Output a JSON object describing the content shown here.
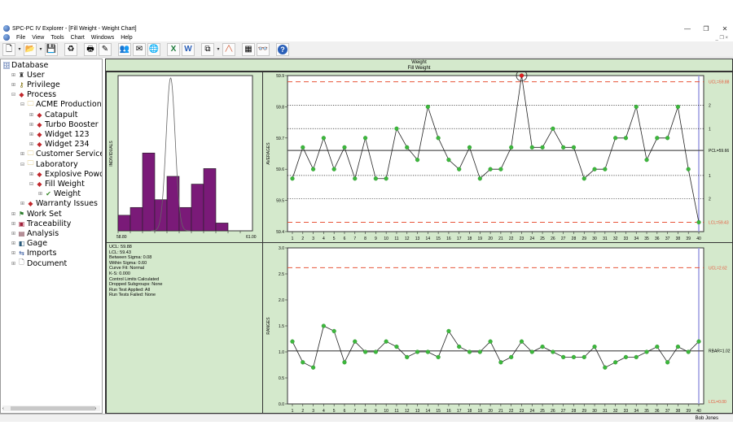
{
  "window": {
    "title": "SPC-PC IV Explorer - [Fill Weight - Weight Chart]",
    "controls": [
      "—",
      "❐",
      "✕"
    ]
  },
  "menu": [
    "File",
    "View",
    "Tools",
    "Chart",
    "Windows",
    "Help"
  ],
  "toolbar": [
    {
      "icon": "new-document-icon",
      "glyph": "🗋",
      "dropdown": true
    },
    {
      "icon": "open-folder-icon",
      "glyph": "📂",
      "dropdown": true
    },
    {
      "icon": "save-icon",
      "glyph": "💾"
    },
    {
      "icon": "refresh-icon",
      "glyph": "♻"
    },
    {
      "icon": "print-icon",
      "glyph": "🖶"
    },
    {
      "icon": "edit-icon",
      "glyph": "✎"
    },
    {
      "icon": "users-icon",
      "glyph": "👥"
    },
    {
      "icon": "message-icon",
      "glyph": "✉"
    },
    {
      "icon": "globe-icon",
      "glyph": "🌐"
    },
    {
      "icon": "excel-icon",
      "glyph": "X"
    },
    {
      "icon": "word-icon",
      "glyph": "W"
    },
    {
      "icon": "copy-icon",
      "glyph": "⧉",
      "dropdown": true
    },
    {
      "icon": "line-chart-icon",
      "glyph": "╱╲"
    },
    {
      "icon": "grid-icon",
      "glyph": "▦"
    },
    {
      "icon": "binoculars-icon",
      "glyph": "👓"
    },
    {
      "icon": "help-icon",
      "glyph": "?"
    }
  ],
  "tree": [
    {
      "label": "Database",
      "level": 0,
      "icon": "database-icon",
      "glyph": "🗄",
      "color": "#2a4f9a"
    },
    {
      "label": "User",
      "level": 1,
      "icon": "user-icon",
      "glyph": "♜",
      "color": "#333"
    },
    {
      "label": "Privilege",
      "level": 1,
      "icon": "key-icon",
      "glyph": "⚷",
      "color": "#7a6a00"
    },
    {
      "label": "Process",
      "level": 1,
      "icon": "process-icon",
      "glyph": "◆",
      "color": "#c0282d",
      "expanded": true
    },
    {
      "label": "ACME Production",
      "level": 2,
      "icon": "folder-icon",
      "glyph": "🗀",
      "color": "#c9a227",
      "expanded": true
    },
    {
      "label": "Catapult",
      "level": 3,
      "icon": "process-icon",
      "glyph": "◆",
      "color": "#c0282d"
    },
    {
      "label": "Turbo Booster",
      "level": 3,
      "icon": "process-icon",
      "glyph": "◆",
      "color": "#c0282d"
    },
    {
      "label": "Widget 123",
      "level": 3,
      "icon": "process-icon",
      "glyph": "◆",
      "color": "#c0282d"
    },
    {
      "label": "Widget 234",
      "level": 3,
      "icon": "process-icon",
      "glyph": "◆",
      "color": "#c0282d"
    },
    {
      "label": "Customer Service",
      "level": 2,
      "icon": "folder-icon",
      "glyph": "🗀",
      "color": "#c9a227"
    },
    {
      "label": "Laboratory",
      "level": 2,
      "icon": "folder-icon",
      "glyph": "🗀",
      "color": "#c9a227",
      "expanded": true
    },
    {
      "label": "Explosive Powder",
      "level": 3,
      "icon": "process-icon",
      "glyph": "◆",
      "color": "#c0282d"
    },
    {
      "label": "Fill Weight",
      "level": 3,
      "icon": "process-icon",
      "glyph": "◆",
      "color": "#c0282d",
      "expanded": true
    },
    {
      "label": "Weight",
      "level": 4,
      "icon": "check-icon",
      "glyph": "✔",
      "color": "#3a8a2a"
    },
    {
      "label": "Warranty Issues",
      "level": 2,
      "icon": "process-icon",
      "glyph": "◆",
      "color": "#c0282d"
    },
    {
      "label": "Work Set",
      "level": 1,
      "icon": "workset-icon",
      "glyph": "⚑",
      "color": "#2a7a2a"
    },
    {
      "label": "Traceability",
      "level": 1,
      "icon": "traceability-icon",
      "glyph": "▣",
      "color": "#a0203a"
    },
    {
      "label": "Analysis",
      "level": 1,
      "icon": "analysis-icon",
      "glyph": "▤",
      "color": "#6a2030"
    },
    {
      "label": "Gage",
      "level": 1,
      "icon": "gage-icon",
      "glyph": "◧",
      "color": "#2a5a7a"
    },
    {
      "label": "Imports",
      "level": 1,
      "icon": "imports-icon",
      "glyph": "⇆",
      "color": "#2a4f9a"
    },
    {
      "label": "Document",
      "level": 1,
      "icon": "document-icon",
      "glyph": "🗋",
      "color": "#555"
    }
  ],
  "header": {
    "line1": "Weight",
    "line2": "Fill Weight"
  },
  "stats": [
    "UCL: 59.88",
    "LCL: 59.43",
    "Between Sigma: 0.08",
    "Within Sigma: 0.60",
    "Curve Fit: Normal",
    "K-S: 0.000",
    "Control Limits Calculated",
    "Dropped Subgroups: None",
    "Run Test Applied: All",
    "Run Tests Failed: None"
  ],
  "status": {
    "user": "Bob Jones"
  },
  "colors": {
    "panel_bg": "#d4e9cc",
    "point": "#3cb83c",
    "out_of_control": "#e02020",
    "limit": "#e8553a",
    "histogram": "#7a1a78",
    "cursor": "#9a9ae0"
  },
  "chart_data": [
    {
      "type": "bar",
      "name": "histogram",
      "ylabel": "INDIVIDUALS",
      "xlim": [
        58.8,
        61.0
      ],
      "xtick_labels": [
        "58.80",
        "61.00"
      ],
      "relative_frequencies": [
        2,
        3,
        10,
        4,
        7,
        3,
        6,
        8,
        1,
        0,
        0
      ],
      "curve_fit": "Normal"
    },
    {
      "type": "line",
      "ylabel": "AVERAGES",
      "ylim": [
        59.4,
        59.9
      ],
      "ytick_labels": [
        "59.4",
        "59.5",
        "59.6",
        "59.7",
        "59.8",
        "59.9"
      ],
      "x": [
        1,
        2,
        3,
        4,
        5,
        6,
        7,
        8,
        9,
        10,
        11,
        12,
        13,
        14,
        15,
        16,
        17,
        18,
        19,
        20,
        21,
        22,
        23,
        24,
        25,
        26,
        27,
        28,
        29,
        30,
        31,
        32,
        33,
        34,
        35,
        36,
        37,
        38,
        39,
        40
      ],
      "values": [
        59.57,
        59.67,
        59.6,
        59.7,
        59.6,
        59.67,
        59.57,
        59.7,
        59.57,
        59.57,
        59.73,
        59.67,
        59.63,
        59.8,
        59.7,
        59.63,
        59.6,
        59.67,
        59.57,
        59.6,
        59.6,
        59.67,
        59.9,
        59.67,
        59.67,
        59.73,
        59.67,
        59.67,
        59.57,
        59.6,
        59.6,
        59.7,
        59.7,
        59.8,
        59.63,
        59.7,
        59.7,
        59.8,
        59.6,
        59.43
      ],
      "out_of_control": [
        23
      ],
      "ucl": 59.88,
      "center": 59.66,
      "lcl": 59.43,
      "sigma_lines": [
        59.805,
        59.73,
        59.58,
        59.505
      ],
      "labels": {
        "ucl": "UCL=59.88",
        "center": "PCL=59.66",
        "lcl": "LCL=59.43",
        "sigma": [
          "2",
          "1",
          "1",
          "2"
        ]
      }
    },
    {
      "type": "line",
      "ylabel": "RANGES",
      "ylim": [
        0,
        3.0
      ],
      "ytick_labels": [
        "0.0",
        "0.5",
        "1.0",
        "1.5",
        "2.0",
        "2.5",
        "3.0"
      ],
      "x": [
        1,
        2,
        3,
        4,
        5,
        6,
        7,
        8,
        9,
        10,
        11,
        12,
        13,
        14,
        15,
        16,
        17,
        18,
        19,
        20,
        21,
        22,
        23,
        24,
        25,
        26,
        27,
        28,
        29,
        30,
        31,
        32,
        33,
        34,
        35,
        36,
        37,
        38,
        39,
        40
      ],
      "values": [
        1.2,
        0.8,
        0.7,
        1.5,
        1.4,
        0.8,
        1.2,
        1.0,
        1.0,
        1.2,
        1.1,
        0.9,
        1.0,
        1.0,
        0.9,
        1.4,
        1.1,
        1.0,
        1.0,
        1.2,
        0.8,
        0.9,
        1.2,
        1.0,
        1.1,
        1.0,
        0.9,
        0.9,
        0.9,
        1.1,
        0.7,
        0.8,
        0.9,
        0.9,
        1.0,
        1.1,
        0.8,
        1.1,
        1.0,
        1.2
      ],
      "ucl": 2.62,
      "center": 1.02,
      "lcl": 0.0,
      "labels": {
        "ucl": "UCL=2.62",
        "center": "RBAR=1.02",
        "lcl": "LCL=0.00"
      }
    }
  ]
}
